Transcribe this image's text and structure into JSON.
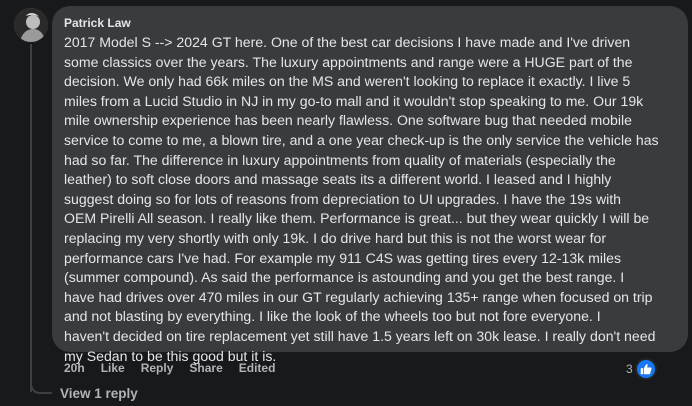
{
  "comment": {
    "author": "Patrick Law",
    "lines": [
      "2017 Model S --> 2024 GT here. One of the best car decisions I have made and I've driven",
      "some classics over the years. The luxury appointments and range were a HUGE part of the",
      "decision. We only had 66k miles on the MS and weren't looking to replace it exactly. I live 5",
      "miles from a Lucid Studio in NJ in my go-to mall and it wouldn't stop speaking to me. Our 19k",
      "mile ownership experience has been nearly flawless. One software bug that needed mobile",
      "service to come to me, a blown tire, and a one year check-up is the only service the vehicle has",
      "had so far. The difference in luxury appointments from quality of materials (especially the",
      "leather) to soft close doors and massage seats its a different world. I leased and I highly",
      "suggest doing so for lots of reasons from depreciation to UI upgrades. I have the 19s with",
      "OEM Pirelli All season. I really like them. Performance is great... but they wear quickly I will be",
      "replacing my very shortly with only 19k. I do drive hard but this is not the worst wear for",
      "performance cars I've had. For example my 911 C4S was getting tires every 12-13k miles",
      "(summer compound). As said the performance is astounding and you get the best range. I",
      "have had drives over 470 miles in our GT regularly achieving 135+ range when focused on trip",
      "and not blasting by everything. I like the look of the wheels too but not fore everyone. I",
      "haven't decided on tire replacement yet still have 1.5 years left on 30k lease. I really don't need",
      "my Sedan to be this good but it is."
    ]
  },
  "actions": {
    "time": "20h",
    "like": "Like",
    "reply": "Reply",
    "share": "Share",
    "edited": "Edited"
  },
  "reactions": {
    "count": "3",
    "icon": "thumbs-up-icon",
    "color": "#1877f2"
  },
  "replies": {
    "label": "View 1 reply"
  }
}
